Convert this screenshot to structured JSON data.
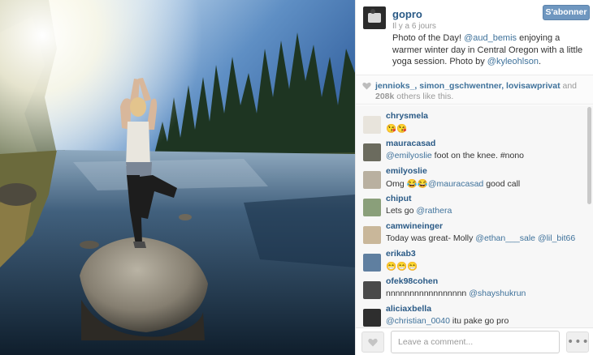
{
  "post": {
    "username": "gopro",
    "time_ago": "Il y a 6 jours",
    "follow_label": "S'abonner",
    "caption": {
      "part1": "Photo of the Day! ",
      "mention1": "@aud_bemis",
      "part2": " enjoying a warmer winter day in Central Oregon with a little yoga session. Photo by ",
      "mention2": "@kyleohlson",
      "part3": "."
    }
  },
  "likes": {
    "names": "jennioks_, simon_gschwentner, lovisawprivat",
    "and": " and ",
    "count": "208k",
    "suffix": " others like this."
  },
  "comments": [
    {
      "user": "chrysmela",
      "text": "😘😘",
      "avatar_color": "#e8e4dc"
    },
    {
      "user": "mauracasad",
      "mention": "@emilyoslie",
      "text": " foot on the knee. #nono",
      "avatar_color": "#6b6b5e"
    },
    {
      "user": "emilyoslie",
      "pre": "Omg 😂😂",
      "mention": "@mauracasad",
      "text": " good call",
      "avatar_color": "#b9b0a0"
    },
    {
      "user": "chiput",
      "pre": "Lets go ",
      "mention": "@rathera",
      "text": "",
      "avatar_color": "#8a9f7a"
    },
    {
      "user": "camwineinger",
      "pre": "Today was great- Molly ",
      "mention": "@ethan___sale",
      "mention2": "@lil_bit66",
      "text": "",
      "avatar_color": "#c9b79a"
    },
    {
      "user": "erikab3",
      "text": "😁😁😁",
      "avatar_color": "#5f7fa0"
    },
    {
      "user": "ofek98cohen",
      "pre": "nnnnnnnnnnnnnnnnn ",
      "mention": "@shayshukrun",
      "text": "",
      "avatar_color": "#4a4a4a"
    },
    {
      "user": "aliciaxbella",
      "mention": "@christian_0040",
      "text": " itu pake go pro",
      "avatar_color": "#2e2e2e"
    }
  ],
  "composer": {
    "placeholder": "Leave a comment...",
    "more_label": "•••"
  },
  "colors": {
    "link": "#3f729b",
    "username": "#2a5a86",
    "follow_button": "#6f97c0"
  }
}
